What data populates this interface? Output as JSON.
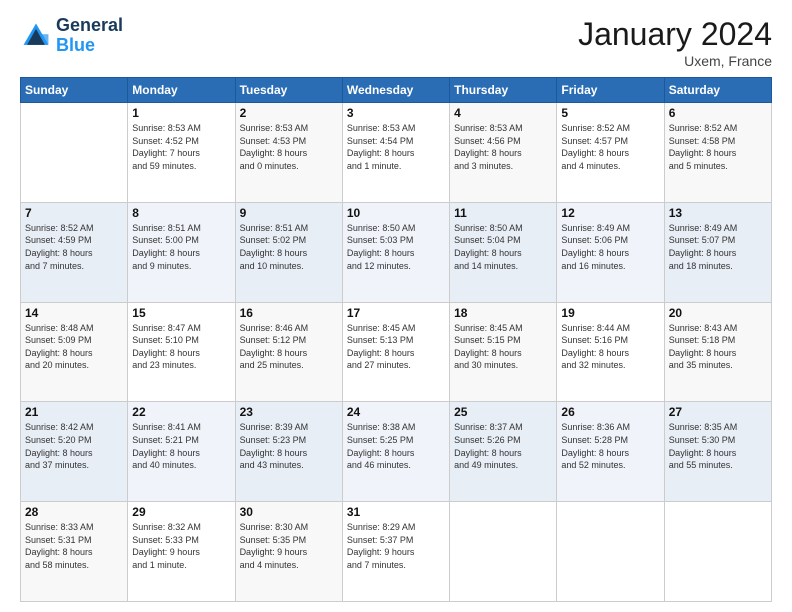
{
  "header": {
    "logo_line1": "General",
    "logo_line2": "Blue",
    "month": "January 2024",
    "location": "Uxem, France"
  },
  "weekdays": [
    "Sunday",
    "Monday",
    "Tuesday",
    "Wednesday",
    "Thursday",
    "Friday",
    "Saturday"
  ],
  "weeks": [
    [
      {
        "day": "",
        "info": ""
      },
      {
        "day": "1",
        "info": "Sunrise: 8:53 AM\nSunset: 4:52 PM\nDaylight: 7 hours\nand 59 minutes."
      },
      {
        "day": "2",
        "info": "Sunrise: 8:53 AM\nSunset: 4:53 PM\nDaylight: 8 hours\nand 0 minutes."
      },
      {
        "day": "3",
        "info": "Sunrise: 8:53 AM\nSunset: 4:54 PM\nDaylight: 8 hours\nand 1 minute."
      },
      {
        "day": "4",
        "info": "Sunrise: 8:53 AM\nSunset: 4:56 PM\nDaylight: 8 hours\nand 3 minutes."
      },
      {
        "day": "5",
        "info": "Sunrise: 8:52 AM\nSunset: 4:57 PM\nDaylight: 8 hours\nand 4 minutes."
      },
      {
        "day": "6",
        "info": "Sunrise: 8:52 AM\nSunset: 4:58 PM\nDaylight: 8 hours\nand 5 minutes."
      }
    ],
    [
      {
        "day": "7",
        "info": "Sunrise: 8:52 AM\nSunset: 4:59 PM\nDaylight: 8 hours\nand 7 minutes."
      },
      {
        "day": "8",
        "info": "Sunrise: 8:51 AM\nSunset: 5:00 PM\nDaylight: 8 hours\nand 9 minutes."
      },
      {
        "day": "9",
        "info": "Sunrise: 8:51 AM\nSunset: 5:02 PM\nDaylight: 8 hours\nand 10 minutes."
      },
      {
        "day": "10",
        "info": "Sunrise: 8:50 AM\nSunset: 5:03 PM\nDaylight: 8 hours\nand 12 minutes."
      },
      {
        "day": "11",
        "info": "Sunrise: 8:50 AM\nSunset: 5:04 PM\nDaylight: 8 hours\nand 14 minutes."
      },
      {
        "day": "12",
        "info": "Sunrise: 8:49 AM\nSunset: 5:06 PM\nDaylight: 8 hours\nand 16 minutes."
      },
      {
        "day": "13",
        "info": "Sunrise: 8:49 AM\nSunset: 5:07 PM\nDaylight: 8 hours\nand 18 minutes."
      }
    ],
    [
      {
        "day": "14",
        "info": "Sunrise: 8:48 AM\nSunset: 5:09 PM\nDaylight: 8 hours\nand 20 minutes."
      },
      {
        "day": "15",
        "info": "Sunrise: 8:47 AM\nSunset: 5:10 PM\nDaylight: 8 hours\nand 23 minutes."
      },
      {
        "day": "16",
        "info": "Sunrise: 8:46 AM\nSunset: 5:12 PM\nDaylight: 8 hours\nand 25 minutes."
      },
      {
        "day": "17",
        "info": "Sunrise: 8:45 AM\nSunset: 5:13 PM\nDaylight: 8 hours\nand 27 minutes."
      },
      {
        "day": "18",
        "info": "Sunrise: 8:45 AM\nSunset: 5:15 PM\nDaylight: 8 hours\nand 30 minutes."
      },
      {
        "day": "19",
        "info": "Sunrise: 8:44 AM\nSunset: 5:16 PM\nDaylight: 8 hours\nand 32 minutes."
      },
      {
        "day": "20",
        "info": "Sunrise: 8:43 AM\nSunset: 5:18 PM\nDaylight: 8 hours\nand 35 minutes."
      }
    ],
    [
      {
        "day": "21",
        "info": "Sunrise: 8:42 AM\nSunset: 5:20 PM\nDaylight: 8 hours\nand 37 minutes."
      },
      {
        "day": "22",
        "info": "Sunrise: 8:41 AM\nSunset: 5:21 PM\nDaylight: 8 hours\nand 40 minutes."
      },
      {
        "day": "23",
        "info": "Sunrise: 8:39 AM\nSunset: 5:23 PM\nDaylight: 8 hours\nand 43 minutes."
      },
      {
        "day": "24",
        "info": "Sunrise: 8:38 AM\nSunset: 5:25 PM\nDaylight: 8 hours\nand 46 minutes."
      },
      {
        "day": "25",
        "info": "Sunrise: 8:37 AM\nSunset: 5:26 PM\nDaylight: 8 hours\nand 49 minutes."
      },
      {
        "day": "26",
        "info": "Sunrise: 8:36 AM\nSunset: 5:28 PM\nDaylight: 8 hours\nand 52 minutes."
      },
      {
        "day": "27",
        "info": "Sunrise: 8:35 AM\nSunset: 5:30 PM\nDaylight: 8 hours\nand 55 minutes."
      }
    ],
    [
      {
        "day": "28",
        "info": "Sunrise: 8:33 AM\nSunset: 5:31 PM\nDaylight: 8 hours\nand 58 minutes."
      },
      {
        "day": "29",
        "info": "Sunrise: 8:32 AM\nSunset: 5:33 PM\nDaylight: 9 hours\nand 1 minute."
      },
      {
        "day": "30",
        "info": "Sunrise: 8:30 AM\nSunset: 5:35 PM\nDaylight: 9 hours\nand 4 minutes."
      },
      {
        "day": "31",
        "info": "Sunrise: 8:29 AM\nSunset: 5:37 PM\nDaylight: 9 hours\nand 7 minutes."
      },
      {
        "day": "",
        "info": ""
      },
      {
        "day": "",
        "info": ""
      },
      {
        "day": "",
        "info": ""
      }
    ]
  ]
}
